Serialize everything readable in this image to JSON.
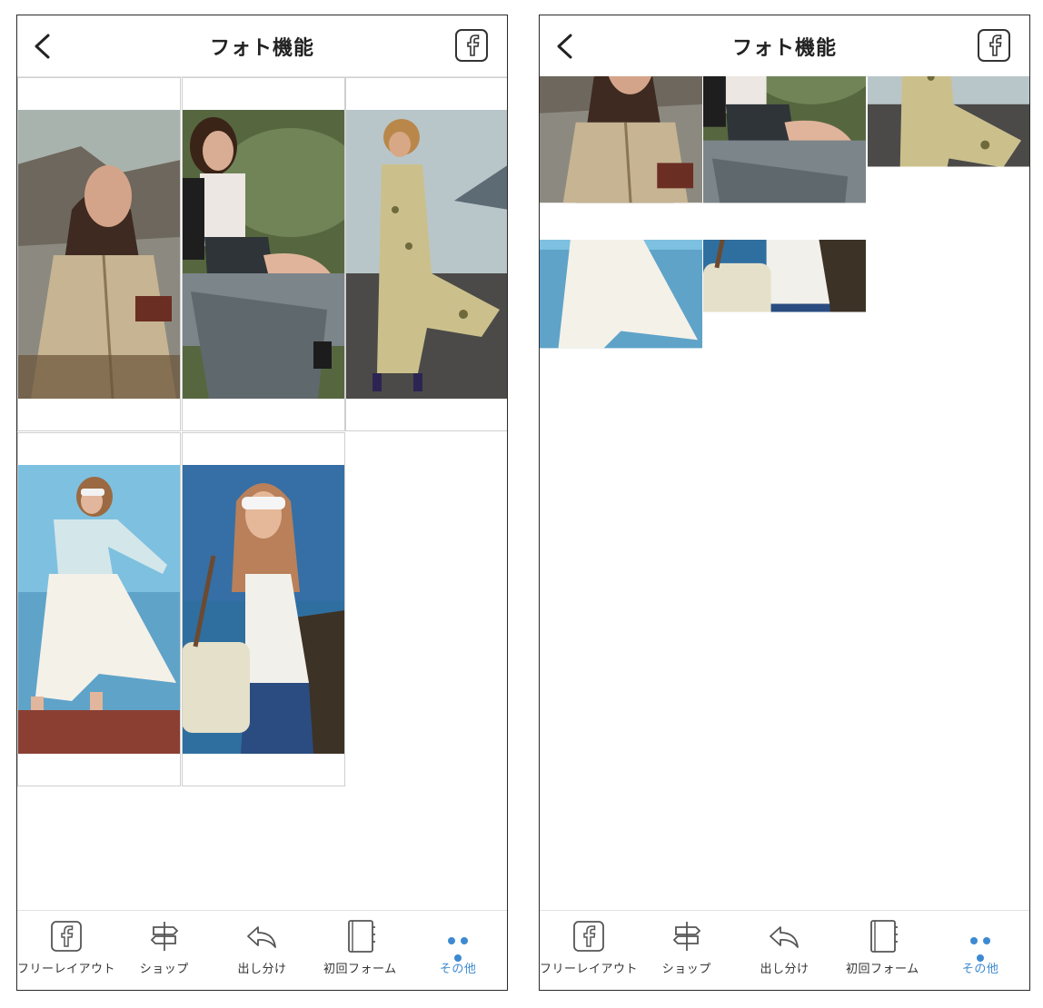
{
  "screens": [
    {
      "header": {
        "title": "フォト機能",
        "back_icon": "chevron-left-icon",
        "share_icon": "facebook-icon"
      },
      "gallery_layout": "tall-tiles",
      "photos": [
        {
          "name": "photo-trench-coat"
        },
        {
          "name": "photo-bench-pose"
        },
        {
          "name": "photo-floral-dress"
        },
        {
          "name": "photo-white-skirt"
        },
        {
          "name": "photo-sunglasses-bag"
        }
      ]
    },
    {
      "header": {
        "title": "フォト機能",
        "back_icon": "chevron-left-icon",
        "share_icon": "facebook-icon"
      },
      "gallery_layout": "square-thumbnails",
      "photos": [
        {
          "name": "photo-trench-coat"
        },
        {
          "name": "photo-bench-pose"
        },
        {
          "name": "photo-floral-dress"
        },
        {
          "name": "photo-white-skirt"
        },
        {
          "name": "photo-sunglasses-bag"
        }
      ]
    }
  ],
  "tabbar": {
    "active_index": 4,
    "active_color": "#3d8ad1",
    "items": [
      {
        "label": "フリーレイアウト",
        "icon": "facebook-icon"
      },
      {
        "label": "ショップ",
        "icon": "signpost-icon"
      },
      {
        "label": "出し分け",
        "icon": "reply-arrow-icon"
      },
      {
        "label": "初回フォーム",
        "icon": "notebook-icon"
      },
      {
        "label": "その他",
        "icon": "more-dots-icon"
      }
    ]
  }
}
